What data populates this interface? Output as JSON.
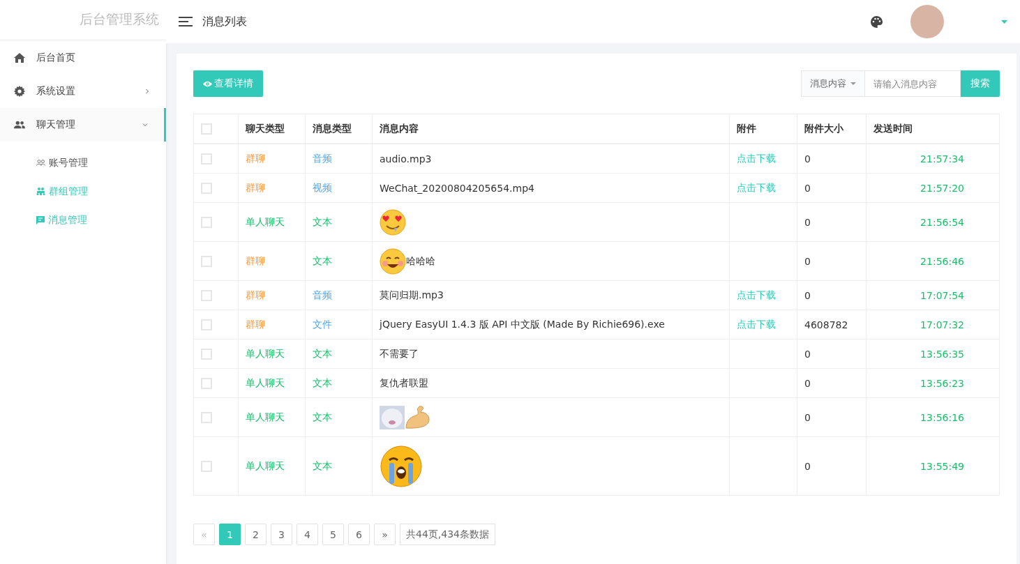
{
  "sidebar": {
    "title": "后台管理系统",
    "items": [
      {
        "kind": "home",
        "label": "后台首页",
        "expanded": false,
        "has_children": false
      },
      {
        "kind": "settings",
        "label": "系统设置",
        "expanded": false,
        "has_children": true
      },
      {
        "kind": "people",
        "label": "聊天管理",
        "expanded": true,
        "has_children": true,
        "children": [
          {
            "kind": "accounts",
            "label": "账号管理",
            "active": false
          },
          {
            "kind": "groups",
            "label": "群组管理",
            "active": true
          },
          {
            "kind": "messages",
            "label": "消息管理",
            "active": true
          }
        ]
      }
    ]
  },
  "header": {
    "title": "消息列表"
  },
  "toolbar": {
    "detail_button": "查看详情",
    "search_select": "消息内容",
    "search_placeholder": "请输入消息内容",
    "search_button": "搜索"
  },
  "table": {
    "all_checked": false,
    "columns": [
      "聊天类型",
      "消息类型",
      "消息内容",
      "附件",
      "附件大小",
      "发送时间"
    ],
    "rows": [
      {
        "checked": false,
        "chat_type": {
          "text": "群聊",
          "color": "#ff9a3c"
        },
        "msg_type": {
          "text": "音频",
          "color": "#4da6f0"
        },
        "content": [
          {
            "kind": "text",
            "text": "audio.mp3"
          }
        ],
        "attachment": "点击下载",
        "size": "0",
        "time": "21:57:34"
      },
      {
        "checked": false,
        "chat_type": {
          "text": "群聊",
          "color": "#ff9a3c"
        },
        "msg_type": {
          "text": "视频",
          "color": "#4da6f0"
        },
        "content": [
          {
            "kind": "text",
            "text": "WeChat_20200804205654.mp4"
          }
        ],
        "attachment": "点击下载",
        "size": "0",
        "time": "21:57:20"
      },
      {
        "checked": false,
        "chat_type": {
          "text": "单人聊天",
          "color": "#19be6b"
        },
        "msg_type": {
          "text": "文本",
          "color": "#19be6b"
        },
        "content": [
          {
            "kind": "heart-eyes"
          }
        ],
        "size": "0",
        "time": "21:56:54"
      },
      {
        "checked": false,
        "chat_type": {
          "text": "群聊",
          "color": "#ff9a3c"
        },
        "msg_type": {
          "text": "文本",
          "color": "#19be6b"
        },
        "content": [
          {
            "kind": "smile"
          },
          {
            "kind": "text",
            "text": "哈哈哈"
          }
        ],
        "size": "0",
        "time": "21:56:46"
      },
      {
        "checked": false,
        "chat_type": {
          "text": "群聊",
          "color": "#ff9a3c"
        },
        "msg_type": {
          "text": "音频",
          "color": "#4da6f0"
        },
        "content": [
          {
            "kind": "text",
            "text": "莫问归期.mp3"
          }
        ],
        "attachment": "点击下载",
        "size": "0",
        "time": "17:07:54"
      },
      {
        "checked": false,
        "chat_type": {
          "text": "群聊",
          "color": "#ff9a3c"
        },
        "msg_type": {
          "text": "文件",
          "color": "#4da6f0"
        },
        "content": [
          {
            "kind": "text",
            "text": "jQuery EasyUI 1.4.3 版 API 中文版 (Made By Richie696).exe"
          }
        ],
        "attachment": "点击下载",
        "size": "4608782",
        "time": "17:07:32"
      },
      {
        "checked": false,
        "chat_type": {
          "text": "单人聊天",
          "color": "#19be6b"
        },
        "msg_type": {
          "text": "文本",
          "color": "#19be6b"
        },
        "content": [
          {
            "kind": "text",
            "text": "不需要了"
          }
        ],
        "size": "0",
        "time": "13:56:35"
      },
      {
        "checked": false,
        "chat_type": {
          "text": "单人聊天",
          "color": "#19be6b"
        },
        "msg_type": {
          "text": "文本",
          "color": "#19be6b"
        },
        "content": [
          {
            "kind": "text",
            "text": "复仇者联盟"
          }
        ],
        "size": "0",
        "time": "13:56:23"
      },
      {
        "checked": false,
        "chat_type": {
          "text": "单人聊天",
          "color": "#19be6b"
        },
        "msg_type": {
          "text": "文本",
          "color": "#19be6b"
        },
        "content": [
          {
            "kind": "sticker"
          },
          {
            "kind": "muscle"
          }
        ],
        "size": "0",
        "time": "13:56:16"
      },
      {
        "checked": false,
        "chat_type": {
          "text": "单人聊天",
          "color": "#19be6b"
        },
        "msg_type": {
          "text": "文本",
          "color": "#19be6b"
        },
        "content": [
          {
            "kind": "crying"
          }
        ],
        "size": "0",
        "time": "13:55:49"
      }
    ]
  },
  "pagination": {
    "prev": "«",
    "pages": [
      {
        "label": "1",
        "selected": true
      },
      {
        "label": "2",
        "selected": false
      },
      {
        "label": "3",
        "selected": false
      },
      {
        "label": "4",
        "selected": false
      },
      {
        "label": "5",
        "selected": false
      },
      {
        "label": "6",
        "selected": false
      }
    ],
    "next": "»",
    "summary": "共44页,434条数据"
  }
}
